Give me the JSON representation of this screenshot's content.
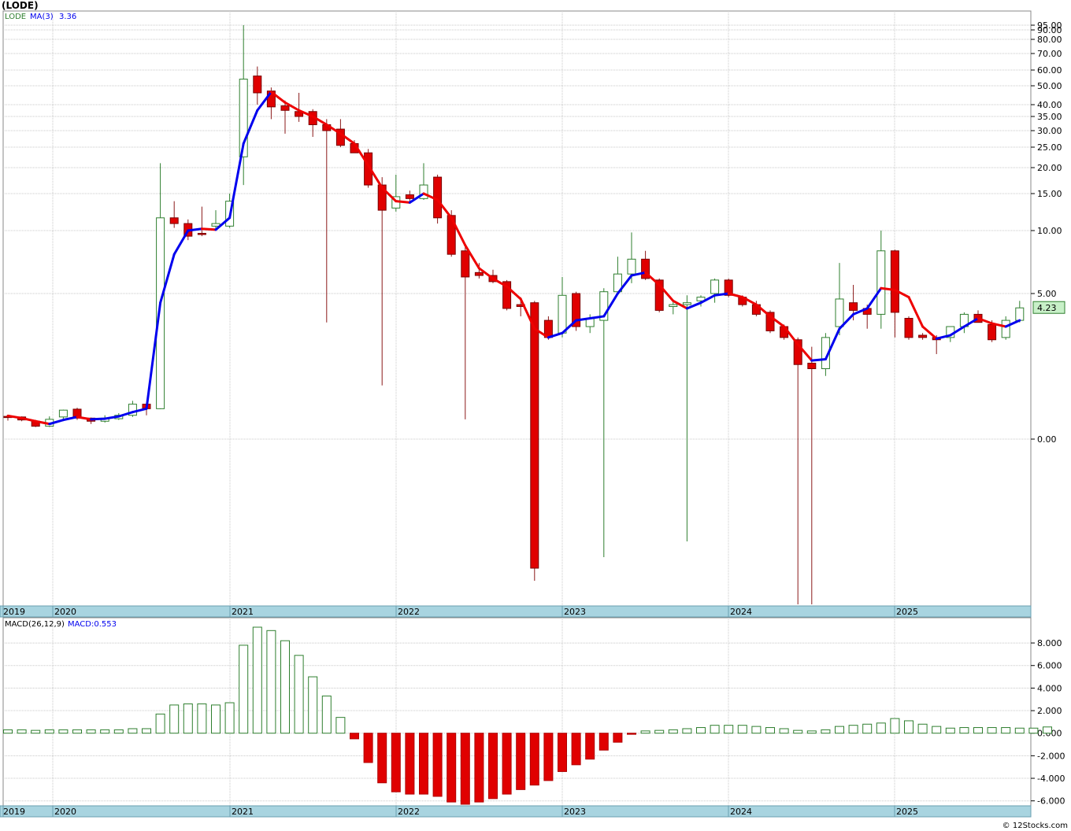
{
  "header": {
    "title": "(LODE)",
    "credit": "© 12Stocks.com"
  },
  "colors": {
    "up": "#1a6b1a",
    "down": "#e00000",
    "ma_up": "#0000ee",
    "ma_down": "#ee0000",
    "axis_band": "#a8d4e0",
    "grid": "#c8c8c8",
    "last_price_bg": "#c8f0c8"
  },
  "chart_data": [
    {
      "type": "candlestick",
      "name": "price",
      "legend": {
        "ticker": "LODE",
        "ma_label": "MA(3)",
        "ma_value": "3.36"
      },
      "last_price": "4.23",
      "scale": "log",
      "y_tick_labels": [
        "95.00",
        "90.00",
        "80.00",
        "70.00",
        "60.00",
        "50.00",
        "40.00",
        "35.00",
        "30.00",
        "25.00",
        "20.00",
        "15.00",
        "10.00",
        "5.00",
        "0.00"
      ],
      "year_labels": [
        "2019",
        "2020",
        "2021",
        "2022",
        "2023",
        "2024",
        "2025"
      ],
      "candles": [
        {
          "o": 0.25,
          "h": 0.28,
          "l": 0.18,
          "c": 0.24
        },
        {
          "o": 0.24,
          "h": 0.25,
          "l": 0.17,
          "c": 0.19
        },
        {
          "o": 0.17,
          "h": 0.19,
          "l": 0.09,
          "c": 0.1
        },
        {
          "o": 0.1,
          "h": 0.25,
          "l": 0.09,
          "c": 0.2
        },
        {
          "o": 0.24,
          "h": 0.38,
          "l": 0.2,
          "c": 0.37
        },
        {
          "o": 0.39,
          "h": 0.42,
          "l": 0.19,
          "c": 0.22
        },
        {
          "o": 0.22,
          "h": 0.23,
          "l": 0.13,
          "c": 0.17
        },
        {
          "o": 0.17,
          "h": 0.27,
          "l": 0.15,
          "c": 0.22
        },
        {
          "o": 0.21,
          "h": 0.31,
          "l": 0.19,
          "c": 0.27
        },
        {
          "o": 0.27,
          "h": 0.58,
          "l": 0.24,
          "c": 0.5
        },
        {
          "o": 0.5,
          "h": 0.5,
          "l": 0.27,
          "c": 0.4
        },
        {
          "o": 0.4,
          "h": 21.0,
          "l": 0.39,
          "c": 11.5
        },
        {
          "o": 11.5,
          "h": 13.8,
          "l": 10.3,
          "c": 10.8
        },
        {
          "o": 10.8,
          "h": 11.3,
          "l": 9.0,
          "c": 9.4
        },
        {
          "o": 9.7,
          "h": 13.0,
          "l": 9.4,
          "c": 9.6
        },
        {
          "o": 10.5,
          "h": 12.5,
          "l": 10.0,
          "c": 10.8
        },
        {
          "o": 10.5,
          "h": 15.0,
          "l": 10.3,
          "c": 13.8
        },
        {
          "o": 22.5,
          "h": 95.0,
          "l": 16.5,
          "c": 54.0
        },
        {
          "o": 56.0,
          "h": 62.0,
          "l": 40.0,
          "c": 46.0
        },
        {
          "o": 47.0,
          "h": 49.0,
          "l": 34.0,
          "c": 39.0
        },
        {
          "o": 39.5,
          "h": 42.0,
          "l": 29.0,
          "c": 37.5
        },
        {
          "o": 37.0,
          "h": 46.0,
          "l": 33.0,
          "c": 35.0
        },
        {
          "o": 37.0,
          "h": 38.0,
          "l": 28.0,
          "c": 32.0
        },
        {
          "o": 32.0,
          "h": 34.0,
          "l": 3.5,
          "c": 30.0
        },
        {
          "o": 30.5,
          "h": 34.0,
          "l": 25.0,
          "c": 25.5
        },
        {
          "o": 26.0,
          "h": 27.0,
          "l": 23.5,
          "c": 23.5
        },
        {
          "o": 23.5,
          "h": 24.5,
          "l": 16.0,
          "c": 16.5
        },
        {
          "o": 16.5,
          "h": 18.0,
          "l": 1.0,
          "c": 12.5
        },
        {
          "o": 12.8,
          "h": 18.5,
          "l": 12.3,
          "c": 14.5
        },
        {
          "o": 14.8,
          "h": 15.5,
          "l": 13.5,
          "c": 14.2
        },
        {
          "o": 14.2,
          "h": 21.0,
          "l": 14.0,
          "c": 16.5
        },
        {
          "o": 18.0,
          "h": 18.5,
          "l": 10.8,
          "c": 11.5
        },
        {
          "o": 11.8,
          "h": 12.5,
          "l": 7.5,
          "c": 7.7
        },
        {
          "o": 8.0,
          "h": 8.5,
          "l": 0.2,
          "c": 6.0
        },
        {
          "o": 6.3,
          "h": 7.0,
          "l": 5.9,
          "c": 6.1
        },
        {
          "o": 6.1,
          "h": 6.5,
          "l": 5.6,
          "c": 5.7
        },
        {
          "o": 5.7,
          "h": 5.8,
          "l": 4.1,
          "c": 4.2
        },
        {
          "o": 4.4,
          "h": 4.8,
          "l": 3.8,
          "c": 4.3
        },
        {
          "o": 4.5,
          "h": 4.6,
          "l": -0.9,
          "c": -0.82
        },
        {
          "o": 3.6,
          "h": 3.8,
          "l": 2.7,
          "c": 2.8
        },
        {
          "o": 3.0,
          "h": 6.0,
          "l": 2.8,
          "c": 4.9
        },
        {
          "o": 5.0,
          "h": 5.1,
          "l": 3.1,
          "c": 3.3
        },
        {
          "o": 3.3,
          "h": 3.9,
          "l": 3.0,
          "c": 3.7
        },
        {
          "o": 3.6,
          "h": 5.3,
          "l": -0.75,
          "c": 5.1
        },
        {
          "o": 5.1,
          "h": 7.5,
          "l": 5.0,
          "c": 6.2
        },
        {
          "o": 6.2,
          "h": 9.8,
          "l": 5.6,
          "c": 7.3
        },
        {
          "o": 7.3,
          "h": 8.0,
          "l": 5.8,
          "c": 5.9
        },
        {
          "o": 5.8,
          "h": 5.9,
          "l": 4.0,
          "c": 4.1
        },
        {
          "o": 4.3,
          "h": 4.6,
          "l": 3.9,
          "c": 4.4
        },
        {
          "o": 4.4,
          "h": 4.9,
          "l": -0.65,
          "c": 4.5
        },
        {
          "o": 4.6,
          "h": 4.9,
          "l": 4.3,
          "c": 4.8
        },
        {
          "o": 5.0,
          "h": 5.9,
          "l": 4.5,
          "c": 5.8
        },
        {
          "o": 5.8,
          "h": 5.9,
          "l": 4.8,
          "c": 4.9
        },
        {
          "o": 4.8,
          "h": 4.9,
          "l": 4.3,
          "c": 4.4
        },
        {
          "o": 4.4,
          "h": 4.6,
          "l": 3.8,
          "c": 3.9
        },
        {
          "o": 4.0,
          "h": 4.1,
          "l": 3.0,
          "c": 3.1
        },
        {
          "o": 3.3,
          "h": 3.4,
          "l": 2.7,
          "c": 2.8
        },
        {
          "o": 2.7,
          "h": 2.8,
          "l": -1.05,
          "c": 1.7
        },
        {
          "o": 1.75,
          "h": 2.4,
          "l": -1.05,
          "c": 1.55
        },
        {
          "o": 1.55,
          "h": 3.0,
          "l": 1.3,
          "c": 2.8
        },
        {
          "o": 3.3,
          "h": 7.0,
          "l": 2.9,
          "c": 4.7
        },
        {
          "o": 4.5,
          "h": 5.5,
          "l": 3.6,
          "c": 4.1
        },
        {
          "o": 4.2,
          "h": 4.4,
          "l": 3.2,
          "c": 3.9
        },
        {
          "o": 3.9,
          "h": 10.0,
          "l": 3.2,
          "c": 8.0
        },
        {
          "o": 8.0,
          "h": 8.1,
          "l": 2.8,
          "c": 4.0
        },
        {
          "o": 3.7,
          "h": 3.8,
          "l": 2.7,
          "c": 2.8
        },
        {
          "o": 2.9,
          "h": 3.0,
          "l": 2.7,
          "c": 2.8
        },
        {
          "o": 2.8,
          "h": 2.9,
          "l": 2.1,
          "c": 2.7
        },
        {
          "o": 2.8,
          "h": 3.3,
          "l": 2.6,
          "c": 3.3
        },
        {
          "o": 3.3,
          "h": 4.0,
          "l": 3.0,
          "c": 3.9
        },
        {
          "o": 3.9,
          "h": 4.1,
          "l": 3.5,
          "c": 3.5
        },
        {
          "o": 3.4,
          "h": 3.6,
          "l": 2.6,
          "c": 2.7
        },
        {
          "o": 2.8,
          "h": 3.8,
          "l": 2.7,
          "c": 3.6
        },
        {
          "o": 3.6,
          "h": 4.6,
          "l": 3.5,
          "c": 4.23
        }
      ],
      "ma": [
        {
          "i": 0,
          "v": 0.26
        },
        {
          "i": 1,
          "v": 0.22
        },
        {
          "i": 2,
          "v": 0.17
        },
        {
          "i": 3,
          "v": 0.13
        },
        {
          "i": 4,
          "v": 0.19
        },
        {
          "i": 5,
          "v": 0.24
        },
        {
          "i": 6,
          "v": 0.2
        },
        {
          "i": 7,
          "v": 0.21
        },
        {
          "i": 8,
          "v": 0.25
        },
        {
          "i": 9,
          "v": 0.33
        },
        {
          "i": 10,
          "v": 0.4
        },
        {
          "i": 11,
          "v": 4.5
        },
        {
          "i": 12,
          "v": 7.7
        },
        {
          "i": 13,
          "v": 10.0
        },
        {
          "i": 14,
          "v": 10.2
        },
        {
          "i": 15,
          "v": 10.1
        },
        {
          "i": 16,
          "v": 11.5
        },
        {
          "i": 17,
          "v": 26.0
        },
        {
          "i": 18,
          "v": 37.5
        },
        {
          "i": 19,
          "v": 46.5
        },
        {
          "i": 20,
          "v": 41.0
        },
        {
          "i": 21,
          "v": 37.5
        },
        {
          "i": 22,
          "v": 35.0
        },
        {
          "i": 23,
          "v": 32.0
        },
        {
          "i": 24,
          "v": 29.0
        },
        {
          "i": 25,
          "v": 26.0
        },
        {
          "i": 26,
          "v": 20.5
        },
        {
          "i": 27,
          "v": 16.0
        },
        {
          "i": 28,
          "v": 13.8
        },
        {
          "i": 29,
          "v": 13.6
        },
        {
          "i": 30,
          "v": 15.0
        },
        {
          "i": 31,
          "v": 14.0
        },
        {
          "i": 32,
          "v": 11.5
        },
        {
          "i": 33,
          "v": 8.5
        },
        {
          "i": 34,
          "v": 6.6
        },
        {
          "i": 35,
          "v": 5.9
        },
        {
          "i": 36,
          "v": 5.4
        },
        {
          "i": 37,
          "v": 4.7
        },
        {
          "i": 38,
          "v": 3.2
        },
        {
          "i": 39,
          "v": 2.8
        },
        {
          "i": 40,
          "v": 3.0
        },
        {
          "i": 41,
          "v": 3.6
        },
        {
          "i": 42,
          "v": 3.7
        },
        {
          "i": 43,
          "v": 3.8
        },
        {
          "i": 44,
          "v": 5.0
        },
        {
          "i": 45,
          "v": 6.1
        },
        {
          "i": 46,
          "v": 6.3
        },
        {
          "i": 47,
          "v": 5.5
        },
        {
          "i": 48,
          "v": 4.6
        },
        {
          "i": 49,
          "v": 4.2
        },
        {
          "i": 50,
          "v": 4.5
        },
        {
          "i": 51,
          "v": 4.9
        },
        {
          "i": 52,
          "v": 5.0
        },
        {
          "i": 53,
          "v": 4.8
        },
        {
          "i": 54,
          "v": 4.4
        },
        {
          "i": 55,
          "v": 3.8
        },
        {
          "i": 56,
          "v": 3.3
        },
        {
          "i": 57,
          "v": 2.5
        },
        {
          "i": 58,
          "v": 1.85
        },
        {
          "i": 59,
          "v": 1.9
        },
        {
          "i": 60,
          "v": 3.2
        },
        {
          "i": 61,
          "v": 3.9
        },
        {
          "i": 62,
          "v": 4.2
        },
        {
          "i": 63,
          "v": 5.3
        },
        {
          "i": 64,
          "v": 5.2
        },
        {
          "i": 65,
          "v": 4.8
        },
        {
          "i": 66,
          "v": 3.3
        },
        {
          "i": 67,
          "v": 2.75
        },
        {
          "i": 68,
          "v": 2.9
        },
        {
          "i": 69,
          "v": 3.3
        },
        {
          "i": 70,
          "v": 3.7
        },
        {
          "i": 71,
          "v": 3.45
        },
        {
          "i": 72,
          "v": 3.3
        },
        {
          "i": 73,
          "v": 3.6
        }
      ]
    },
    {
      "type": "bar",
      "name": "macd",
      "legend": {
        "label": "MACD(26,12,9)",
        "value_label": "MACD:0.553"
      },
      "y_tick_labels": [
        "8.000",
        "6.000",
        "4.000",
        "2.000",
        "0.000",
        "-2.000",
        "-4.000",
        "-6.000"
      ],
      "ylim": [
        -6.3,
        9.4
      ],
      "year_labels": [
        "2019",
        "2020",
        "2021",
        "2022",
        "2023",
        "2024",
        "2025"
      ],
      "values": [
        0.3,
        0.3,
        0.25,
        0.3,
        0.3,
        0.3,
        0.3,
        0.3,
        0.3,
        0.4,
        0.4,
        1.7,
        2.5,
        2.6,
        2.6,
        2.5,
        2.7,
        7.8,
        9.4,
        9.1,
        8.2,
        6.9,
        5.0,
        3.3,
        1.4,
        -0.5,
        -2.6,
        -4.4,
        -5.2,
        -5.4,
        -5.4,
        -5.6,
        -6.1,
        -6.3,
        -6.1,
        -5.8,
        -5.4,
        -5.0,
        -4.6,
        -4.2,
        -3.4,
        -2.8,
        -2.3,
        -1.5,
        -0.8,
        -0.1,
        0.2,
        0.25,
        0.3,
        0.4,
        0.5,
        0.7,
        0.7,
        0.7,
        0.6,
        0.5,
        0.4,
        0.25,
        0.2,
        0.3,
        0.6,
        0.7,
        0.8,
        0.9,
        1.3,
        1.1,
        0.8,
        0.6,
        0.45,
        0.5,
        0.5,
        0.5,
        0.5,
        0.45,
        0.45,
        0.553
      ]
    }
  ]
}
